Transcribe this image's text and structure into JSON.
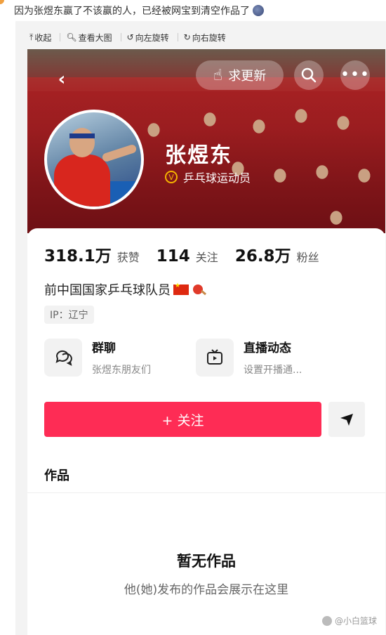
{
  "post": {
    "title": "因为张煜东赢了不该赢的人，已经被网宝到清空作品了"
  },
  "toolbar": {
    "items": [
      {
        "icon": "collapse-icon",
        "label": "收起"
      },
      {
        "icon": "zoom-icon",
        "label": "查看大图"
      },
      {
        "icon": "rotate-left-icon",
        "label": "向左旋转"
      },
      {
        "icon": "rotate-right-icon",
        "label": "向右旋转"
      }
    ]
  },
  "profile": {
    "request_update_label": "求更新",
    "name": "张煜东",
    "verified_label": "乒乓球运动员",
    "verified_badge": "V",
    "stats": [
      {
        "value": "318.1万",
        "label": "获赞"
      },
      {
        "value": "114",
        "label": "关注"
      },
      {
        "value": "26.8万",
        "label": "粉丝"
      }
    ],
    "bio": "前中国国家乒乓球队员",
    "ip": "IP：辽宁",
    "features": [
      {
        "icon": "group-chat-icon",
        "title": "群聊",
        "subtitle": "张煜东朋友们"
      },
      {
        "icon": "live-tv-icon",
        "title": "直播动态",
        "subtitle": "设置开播通..."
      }
    ],
    "follow_label": "+ 关注",
    "works_title": "作品",
    "empty_title": "暂无作品",
    "empty_subtitle": "他(她)发布的作品会展示在这里"
  },
  "watermark": "@小白篮球",
  "colors": {
    "accent": "#fe2c55",
    "banner": "#8e1c20",
    "verified": "#f5b400"
  }
}
